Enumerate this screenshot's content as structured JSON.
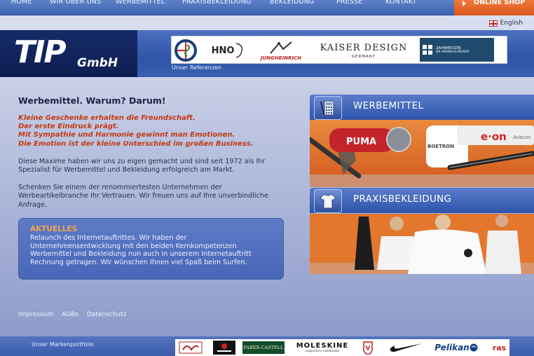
{
  "nav": {
    "items": [
      "HOME",
      "WIR ÜBER UNS",
      "WERBEMITTEL",
      "PRAXISBEKLEIDUNG",
      "BEKLEIDUNG",
      "PRESSE",
      "KONTAKT"
    ],
    "online_shop": "ONLINE SHOP"
  },
  "language": {
    "label": "English",
    "icon": "uk-flag-icon"
  },
  "logo": {
    "name": "TIP",
    "suffix": "GmbH"
  },
  "references": {
    "caption": "Unser Referenzen",
    "logos": [
      "HNO",
      "JUNGHEINRICH",
      "KAISER DESIGN",
      "GERMANY",
      "ZAHNMEDIZIN",
      "DR ANDREAS MOSER"
    ]
  },
  "main": {
    "heading": "Werbemittel. Warum? Darum!",
    "slogan": [
      "Kleine Geschenke erhalten die Freundschaft.",
      "Der erste Eindruck prägt.",
      "Mit Sympathie und Harmonie gewinnt man Emotionen.",
      "Die Emotion ist der kleine Unterschied im großen Business."
    ],
    "para1": "Diese Maxime haben wir uns zu eigen gemacht und sind seit 1972 als Ihr Spezialist für Werbemittel und Bekleidung erfolgreich am Markt.",
    "para2": "Schenken Sie einem der renommiertesten Unternehmen der Werbeartikelbranche Ihr Vertrauen. Wir freuen uns auf Ihre unverbindliche Anfrage."
  },
  "news": {
    "title": "AKTUELLES",
    "text": "Relaunch des Internetauftrittes. Wir haben der Unternehmensentwicklung mit den beiden Kernkompetenzen Werbemittel und Bekleidung nun auch in unserem Internetauftritt Rechnung getragen. Wir wünschen Ihnen viel Spaß beim Surfen."
  },
  "footer": {
    "links": [
      "Impressum",
      "AGBs",
      "Datenschutz"
    ]
  },
  "panels": {
    "werbemittel": {
      "label": "WERBEMITTEL",
      "brands": [
        "PUMA",
        "e·on",
        "Avacon",
        "BOETRON"
      ]
    },
    "praxis": {
      "label": "PRAXISBEKLEIDUNG"
    }
  },
  "brands": {
    "caption": "Unser Markenportfolio",
    "items": [
      "FABER-CASTELL",
      "MOLESKINE",
      "Legendary notebooks",
      "Pelikan",
      "ras"
    ]
  },
  "colors": {
    "accent": "#c23a12",
    "nav": "#4a6dbb",
    "shop": "#e4662a",
    "news_title": "#f3a74a"
  }
}
